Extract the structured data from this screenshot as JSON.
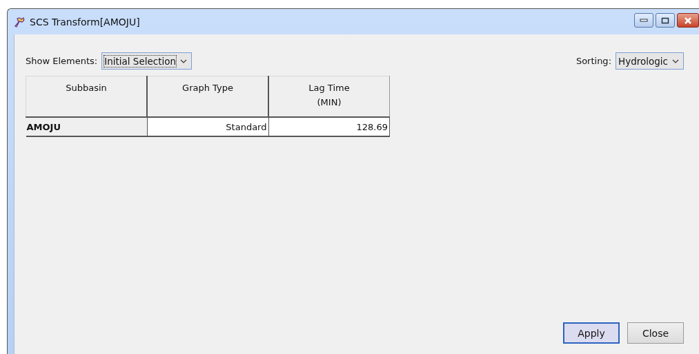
{
  "window": {
    "title": "SCS Transform[AMOJU]"
  },
  "show_elements": {
    "label": "Show Elements:",
    "value": "Initial Selection"
  },
  "sorting": {
    "label": "Sorting:",
    "value": "Hydrologic"
  },
  "table": {
    "columns": [
      {
        "label": "Subbasin",
        "editable": false
      },
      {
        "label": "Graph Type",
        "editable": true
      },
      {
        "label": "Lag Time",
        "unit": "(MIN)",
        "editable": true
      }
    ],
    "rows": [
      {
        "cells": [
          "AMOJU",
          "Standard",
          "128.69"
        ]
      }
    ]
  },
  "buttons": [
    {
      "label": "Apply",
      "default": true
    },
    {
      "label": "Close",
      "default": false
    }
  ]
}
